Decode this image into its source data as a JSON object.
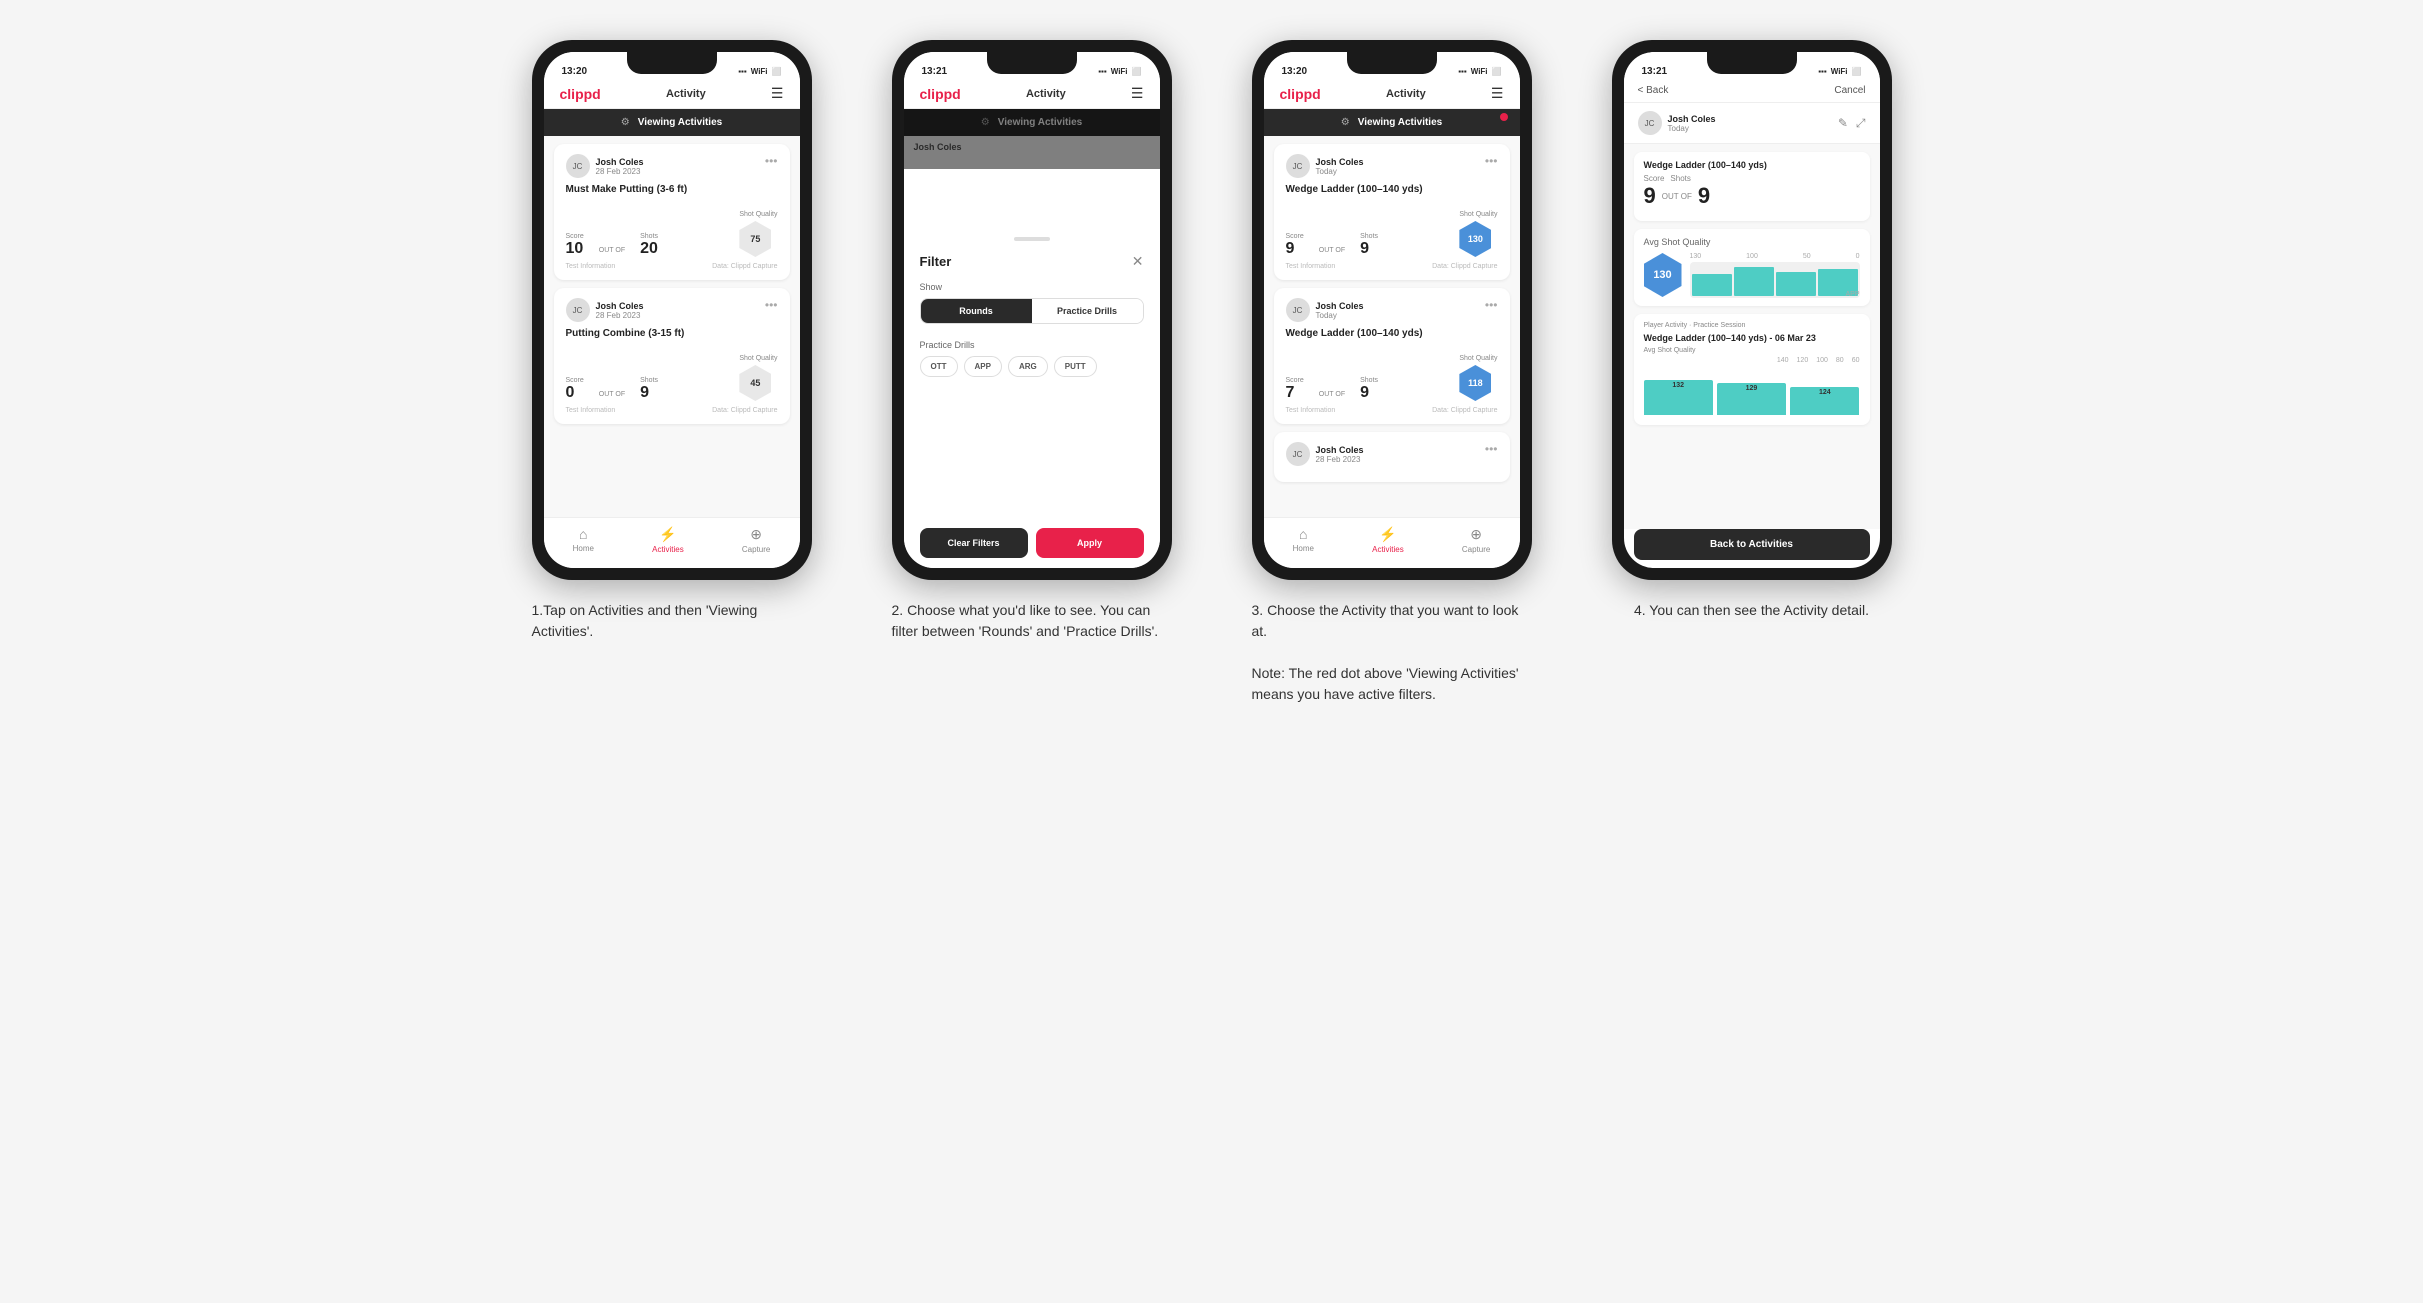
{
  "screens": [
    {
      "id": "screen1",
      "status_time": "13:20",
      "header_title": "Activity",
      "viewing_label": "Viewing Activities",
      "has_red_dot": false,
      "caption": "1.Tap on Activities and then 'Viewing Activities'.",
      "cards": [
        {
          "user_name": "Josh Coles",
          "user_date": "28 Feb 2023",
          "title": "Must Make Putting (3-6 ft)",
          "score_label": "Score",
          "shots_label": "Shots",
          "sq_label": "Shot Quality",
          "score_value": "10",
          "out_of": "OUT OF",
          "shots_value": "20",
          "sq_value": "75",
          "sq_color": "grey",
          "test_info": "Test Information",
          "data_source": "Data: Clippd Capture"
        },
        {
          "user_name": "Josh Coles",
          "user_date": "28 Feb 2023",
          "title": "Putting Combine (3-15 ft)",
          "score_label": "Score",
          "shots_label": "Shots",
          "sq_label": "Shot Quality",
          "score_value": "0",
          "out_of": "OUT OF",
          "shots_value": "9",
          "sq_value": "45",
          "sq_color": "grey",
          "test_info": "Test Information",
          "data_source": "Data: Clippd Capture"
        }
      ]
    },
    {
      "id": "screen2",
      "status_time": "13:21",
      "header_title": "Activity",
      "viewing_label": "Viewing Activities",
      "has_red_dot": false,
      "filter_title": "Filter",
      "show_label": "Show",
      "toggle_rounds": "Rounds",
      "toggle_drills": "Practice Drills",
      "practice_drills_label": "Practice Drills",
      "pills": [
        "OTT",
        "APP",
        "ARG",
        "PUTT"
      ],
      "btn_clear": "Clear Filters",
      "btn_apply": "Apply",
      "caption": "2. Choose what you'd like to see. You can filter between 'Rounds' and 'Practice Drills'.",
      "dim_user": "Josh Coles"
    },
    {
      "id": "screen3",
      "status_time": "13:20",
      "header_title": "Activity",
      "viewing_label": "Viewing Activities",
      "has_red_dot": true,
      "caption": "3. Choose the Activity that you want to look at.\n\nNote: The red dot above 'Viewing Activities' means you have active filters.",
      "cards": [
        {
          "user_name": "Josh Coles",
          "user_date": "Today",
          "title": "Wedge Ladder (100–140 yds)",
          "score_label": "Score",
          "shots_label": "Shots",
          "sq_label": "Shot Quality",
          "score_value": "9",
          "out_of": "OUT OF",
          "shots_value": "9",
          "sq_value": "130",
          "sq_color": "blue",
          "test_info": "Test Information",
          "data_source": "Data: Clippd Capture"
        },
        {
          "user_name": "Josh Coles",
          "user_date": "Today",
          "title": "Wedge Ladder (100–140 yds)",
          "score_label": "Score",
          "shots_label": "Shots",
          "sq_label": "Shot Quality",
          "score_value": "7",
          "out_of": "OUT OF",
          "shots_value": "9",
          "sq_value": "118",
          "sq_color": "blue",
          "test_info": "Test Information",
          "data_source": "Data: Clippd Capture"
        }
      ]
    },
    {
      "id": "screen4",
      "status_time": "13:21",
      "back_label": "< Back",
      "cancel_label": "Cancel",
      "user_name": "Josh Coles",
      "user_date": "Today",
      "detail_title": "Wedge Ladder (100–140 yds)",
      "score_label": "Score",
      "shots_label": "Shots",
      "big_score": "9",
      "out_of": "OUT OF",
      "big_shots": "9",
      "sq_label": "Avg Shot Quality",
      "sq_value": "130",
      "chart_bars": [
        80,
        100,
        75,
        95
      ],
      "chart_values": [
        "132",
        "129",
        "124"
      ],
      "session_label": "Player Activity · Practice Session",
      "session_title": "Wedge Ladder (100–140 yds) - 06 Mar 23",
      "session_sq": "Avg Shot Quality",
      "back_activities": "Back to Activities",
      "caption": "4. You can then see the Activity detail."
    }
  ],
  "icons": {
    "home": "⌂",
    "activities": "♟",
    "capture": "⊕",
    "filter": "⚙",
    "more": "•••",
    "back_chevron": "‹",
    "close": "✕",
    "edit": "✎",
    "expand": "⤢",
    "info": "ⓘ"
  }
}
